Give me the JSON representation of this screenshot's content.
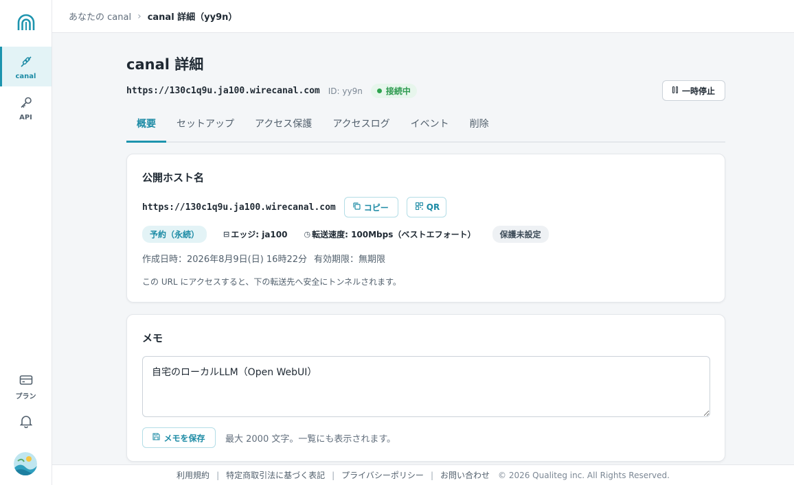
{
  "sidebar": {
    "nav": [
      {
        "label": "canal",
        "icon": "link-icon",
        "active": true
      },
      {
        "label": "API",
        "icon": "key-icon"
      }
    ],
    "bottom": [
      {
        "label": "プラン",
        "icon": "credit-card-icon"
      },
      {
        "label": "",
        "icon": "bell-icon"
      }
    ]
  },
  "breadcrumb": {
    "parent": "あなたの canal",
    "current": "canal 詳細（yy9n）"
  },
  "header": {
    "title": "canal 詳細",
    "host": "https://130c1q9u.ja100.wirecanal.com",
    "id_text": "ID: yy9n",
    "status": "接続中",
    "pause_label": "一時停止"
  },
  "tabs": [
    {
      "label": "概要",
      "active": true
    },
    {
      "label": "セットアップ"
    },
    {
      "label": "アクセス保護"
    },
    {
      "label": "アクセスログ"
    },
    {
      "label": "イベント"
    },
    {
      "label": "削除"
    }
  ],
  "public_host": {
    "title": "公開ホスト名",
    "host": "https://130c1q9u.ja100.wirecanal.com",
    "copy_label": "コピー",
    "qr_label": "QR",
    "plan_badge": "予約（永続）",
    "edge": "エッジ: ja100",
    "speed": "転送速度: 100Mbps（ベストエフォート）",
    "protection": "保護未設定",
    "created": "作成日時：2026年8月9日(日) 16時22分",
    "expiry": "有効期限：無期限",
    "description": "この URL にアクセスすると、下の転送先へ安全にトンネルされます。"
  },
  "memo": {
    "title": "メモ",
    "value": "自宅のローカルLLM（Open WebUI）",
    "save_label": "メモを保存",
    "hint": "最大 2000 文字。一覧にも表示されます。"
  },
  "footer": {
    "links": [
      "利用規約",
      "特定商取引法に基づく表記",
      "プライバシーポリシー",
      "お問い合わせ"
    ],
    "copyright": "© 2026 Qualiteg inc. All Rights Reserved."
  },
  "colors": {
    "accent": "#1d94ae",
    "status_green": "#2fa44f"
  }
}
